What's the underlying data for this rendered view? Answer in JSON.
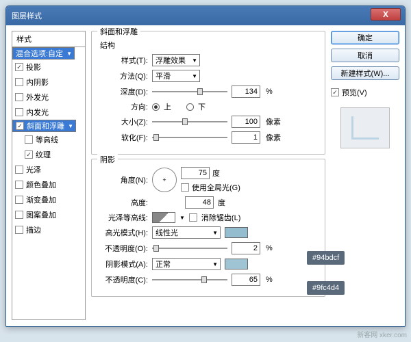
{
  "window": {
    "title": "图层样式"
  },
  "styles": {
    "header": "样式",
    "blend": "混合选项:自定",
    "items": [
      {
        "label": "投影",
        "checked": true
      },
      {
        "label": "内阴影",
        "checked": false
      },
      {
        "label": "外发光",
        "checked": false
      },
      {
        "label": "内发光",
        "checked": false
      },
      {
        "label": "斜面和浮雕",
        "checked": true,
        "selected": true
      },
      {
        "label": "等高线",
        "checked": false,
        "indent": true
      },
      {
        "label": "纹理",
        "checked": true,
        "indent": true
      },
      {
        "label": "光泽",
        "checked": false
      },
      {
        "label": "颜色叠加",
        "checked": false
      },
      {
        "label": "渐变叠加",
        "checked": false
      },
      {
        "label": "图案叠加",
        "checked": false
      },
      {
        "label": "描边",
        "checked": false
      }
    ]
  },
  "bevel": {
    "group": "斜面和浮雕",
    "structure": "结构",
    "style_lbl": "样式(T):",
    "style_val": "浮雕效果",
    "tech_lbl": "方法(Q):",
    "tech_val": "平滑",
    "depth_lbl": "深度(D):",
    "depth_val": "134",
    "pct": "%",
    "dir_lbl": "方向:",
    "up": "上",
    "down": "下",
    "size_lbl": "大小(Z):",
    "size_val": "100",
    "px": "像素",
    "soft_lbl": "软化(F):",
    "soft_val": "1"
  },
  "shade": {
    "group": "阴影",
    "angle_lbl": "角度(N):",
    "angle_val": "75",
    "deg": "度",
    "global": "使用全局光(G)",
    "alt_lbl": "高度:",
    "alt_val": "48",
    "gloss_lbl": "光泽等高线:",
    "aa": "消除锯齿(L)",
    "hmode_lbl": "高光模式(H):",
    "hmode_val": "线性光",
    "hcolor": "#94bdcf",
    "hcolor_label": "#94bdcf",
    "hop_lbl": "不透明度(O):",
    "hop_val": "2",
    "smode_lbl": "阴影模式(A):",
    "smode_val": "正常",
    "scolor": "#9fc4d4",
    "scolor_label": "#9fc4d4",
    "sop_lbl": "不透明度(C):",
    "sop_val": "65"
  },
  "buttons": {
    "ok": "确定",
    "cancel": "取消",
    "newstyle": "新建样式(W)...",
    "preview": "预览(V)"
  },
  "watermark": "新客网 xker.com"
}
